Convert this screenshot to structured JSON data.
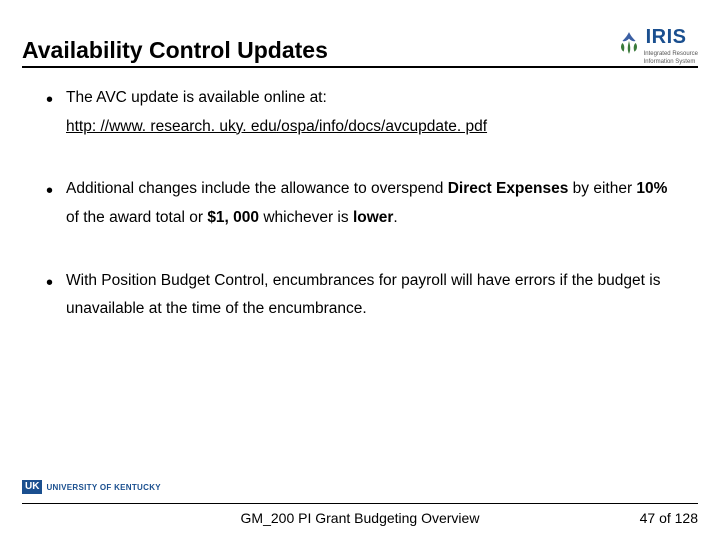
{
  "header": {
    "title": "Availability Control Updates",
    "logo_name": "IRIS",
    "logo_subline1": "Integrated Resource",
    "logo_subline2": "Information System"
  },
  "bullets": {
    "b1_line1": "The AVC update is available online at:",
    "b1_link": "http: //www. research. uky. edu/ospa/info/docs/avcupdate. pdf",
    "b2_pre": "Additional changes include the allowance to overspend ",
    "b2_bold1": "Direct Expenses",
    "b2_mid1": " by either ",
    "b2_bold2": "10%",
    "b2_mid2": " of the award total or ",
    "b2_bold3": "$1, 000",
    "b2_mid3": " whichever is ",
    "b2_bold4": "lower",
    "b2_end": ".",
    "b3": "With Position Budget Control, encumbrances for payroll will have errors if the budget is unavailable at the time of the encumbrance."
  },
  "footer": {
    "uk_mark": "UK",
    "uk_text": "UNIVERSITY OF KENTUCKY",
    "center": "GM_200 PI Grant Budgeting Overview",
    "page": "47 of 128"
  }
}
